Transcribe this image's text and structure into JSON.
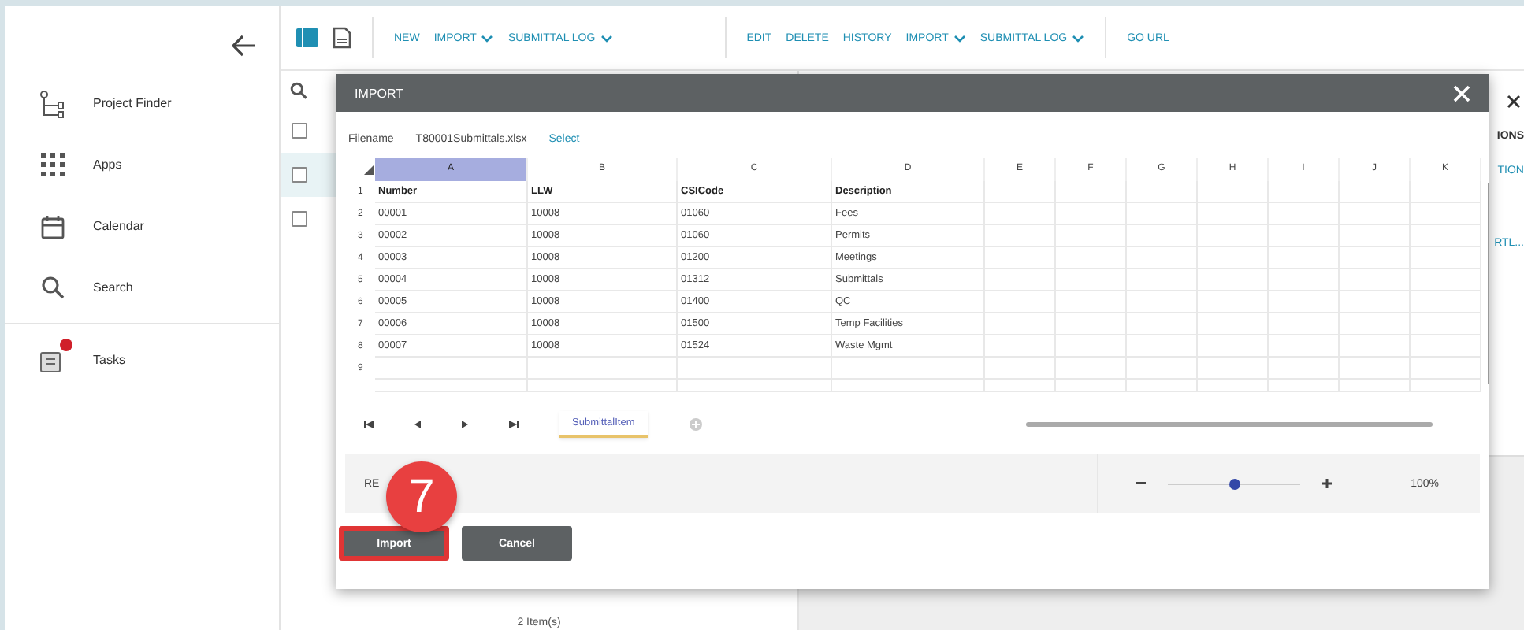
{
  "sidebar": {
    "items": [
      {
        "label": "Project Finder",
        "badge": false
      },
      {
        "label": "Apps",
        "badge": false
      },
      {
        "label": "Calendar",
        "badge": false
      },
      {
        "label": "Search",
        "badge": false
      },
      {
        "label": "Tasks",
        "badge": true
      }
    ]
  },
  "toolbar": {
    "left_actions": [
      {
        "label": "NEW",
        "dropdown": false
      },
      {
        "label": "IMPORT",
        "dropdown": true
      },
      {
        "label": "SUBMITTAL LOG",
        "dropdown": true
      }
    ],
    "right_actions": [
      {
        "label": "EDIT",
        "dropdown": false
      },
      {
        "label": "DELETE",
        "dropdown": false
      },
      {
        "label": "HISTORY",
        "dropdown": false
      },
      {
        "label": "IMPORT",
        "dropdown": true
      },
      {
        "label": "SUBMITTAL LOG",
        "dropdown": true
      }
    ],
    "link": "GO URL"
  },
  "list": {
    "rows": [
      {
        "selected": false
      },
      {
        "selected": true
      },
      {
        "selected": false
      }
    ],
    "footer": "2 Item(s)"
  },
  "detail": {
    "texts": [
      "IONS",
      "TION",
      "RTL..."
    ]
  },
  "dialog": {
    "title": "IMPORT",
    "filename_label": "Filename",
    "filename": "T80001Submittals.xlsx",
    "select_link": "Select",
    "sheet": {
      "columns": [
        {
          "label": "A",
          "selected": true
        },
        {
          "label": "B",
          "selected": false
        },
        {
          "label": "C",
          "selected": false
        },
        {
          "label": "D",
          "selected": false
        },
        {
          "label": "E",
          "selected": false
        },
        {
          "label": "F",
          "selected": false
        },
        {
          "label": "G",
          "selected": false
        },
        {
          "label": "H",
          "selected": false
        },
        {
          "label": "I",
          "selected": false
        },
        {
          "label": "J",
          "selected": false
        },
        {
          "label": "K",
          "selected": false
        }
      ],
      "header_row": {
        "number": "1",
        "cells": [
          "Number",
          "LLW",
          "CSICode",
          "Description"
        ]
      },
      "rows": [
        {
          "number": "2",
          "cells": [
            "00001",
            "10008",
            "01060",
            "Fees"
          ]
        },
        {
          "number": "3",
          "cells": [
            "00002",
            "10008",
            "01060",
            "Permits"
          ]
        },
        {
          "number": "4",
          "cells": [
            "00003",
            "10008",
            "01200",
            "Meetings"
          ]
        },
        {
          "number": "5",
          "cells": [
            "00004",
            "10008",
            "01312",
            "Submittals"
          ]
        },
        {
          "number": "6",
          "cells": [
            "00005",
            "10008",
            "01400",
            "QC"
          ]
        },
        {
          "number": "7",
          "cells": [
            "00006",
            "10008",
            "01500",
            "Temp Facilities"
          ]
        },
        {
          "number": "8",
          "cells": [
            "00007",
            "10008",
            "01524",
            "Waste Mgmt"
          ]
        },
        {
          "number": "9",
          "cells": []
        }
      ],
      "tabs": [
        {
          "label": "SubmittalItem",
          "selected": true
        }
      ]
    },
    "status": "RE",
    "zoom": {
      "level": 0.5,
      "reading": "100%"
    },
    "buttons": [
      {
        "label": "Import",
        "highlighted": true
      },
      {
        "label": "Cancel",
        "highlighted": false
      }
    ]
  },
  "step_marker": "7"
}
